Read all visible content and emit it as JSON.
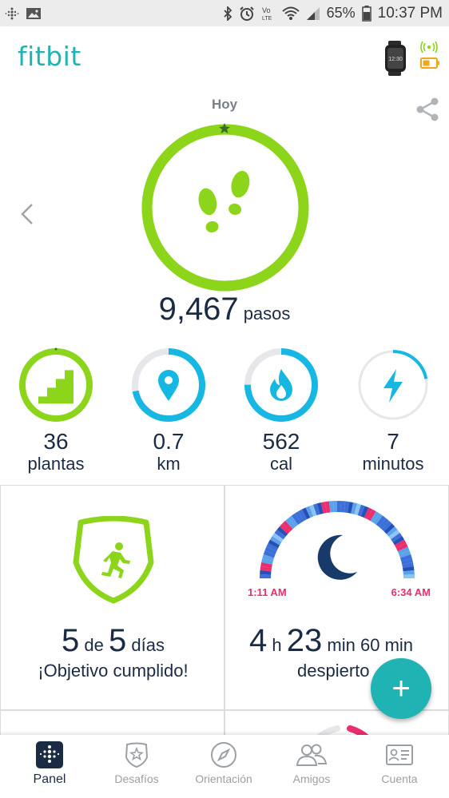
{
  "status_bar": {
    "battery_percent": "65%",
    "time": "10:37 PM",
    "icons": [
      "fitbit-notification-icon",
      "image-notification-icon",
      "bluetooth-icon",
      "alarm-icon",
      "volte-icon",
      "wifi-icon",
      "signal-icon",
      "battery-icon"
    ]
  },
  "app": {
    "logo": "fitbit",
    "device": {
      "icon": "smartwatch-icon",
      "sync_icon": "sync-signal-icon",
      "battery_icon": "device-battery-icon"
    }
  },
  "today": {
    "label": "Hoy",
    "steps_value": "9,467",
    "steps_unit": "pasos",
    "steps_goal_fraction": 1.0
  },
  "stats": [
    {
      "key": "floors",
      "value": "36",
      "unit": "plantas",
      "icon": "stairs-icon",
      "progress": 1.0,
      "color": "#8cd51a"
    },
    {
      "key": "distance",
      "value": "0.7",
      "unit": "km",
      "icon": "location-pin-icon",
      "progress": 0.72,
      "color": "#16b8e3"
    },
    {
      "key": "calories",
      "value": "562",
      "unit": "cal",
      "icon": "flame-icon",
      "progress": 0.75,
      "color": "#16b8e3"
    },
    {
      "key": "active_minutes",
      "value": "7",
      "unit": "minutos",
      "icon": "lightning-icon",
      "progress": 0.22,
      "color": "#16b8e3"
    }
  ],
  "tiles": {
    "exercise": {
      "value_a": "5",
      "text_de": "de",
      "value_b": "5",
      "text_days": "días",
      "subtitle": "¡Objetivo cumplido!",
      "icon": "runner-badge-icon"
    },
    "sleep": {
      "start_time": "1:11 AM",
      "end_time": "6:34 AM",
      "hours": "4",
      "hours_unit": "h",
      "minutes": "23",
      "minutes_unit": "min",
      "awake_value": "60",
      "awake_unit": "min",
      "awake_label": "despierto",
      "icon": "moon-icon"
    }
  },
  "fab": {
    "label": "+"
  },
  "nav": [
    {
      "label": "Panel",
      "icon": "dashboard-icon",
      "active": true
    },
    {
      "label": "Desafíos",
      "icon": "challenges-star-icon",
      "active": false
    },
    {
      "label": "Orientación",
      "icon": "compass-icon",
      "active": false
    },
    {
      "label": "Amigos",
      "icon": "friends-icon",
      "active": false
    },
    {
      "label": "Cuenta",
      "icon": "account-card-icon",
      "active": false
    }
  ],
  "colors": {
    "teal": "#1fb3b3",
    "green": "#8cd51a",
    "blue": "#16b8e3",
    "navy": "#1c2b44",
    "pink": "#ec2d6e"
  }
}
